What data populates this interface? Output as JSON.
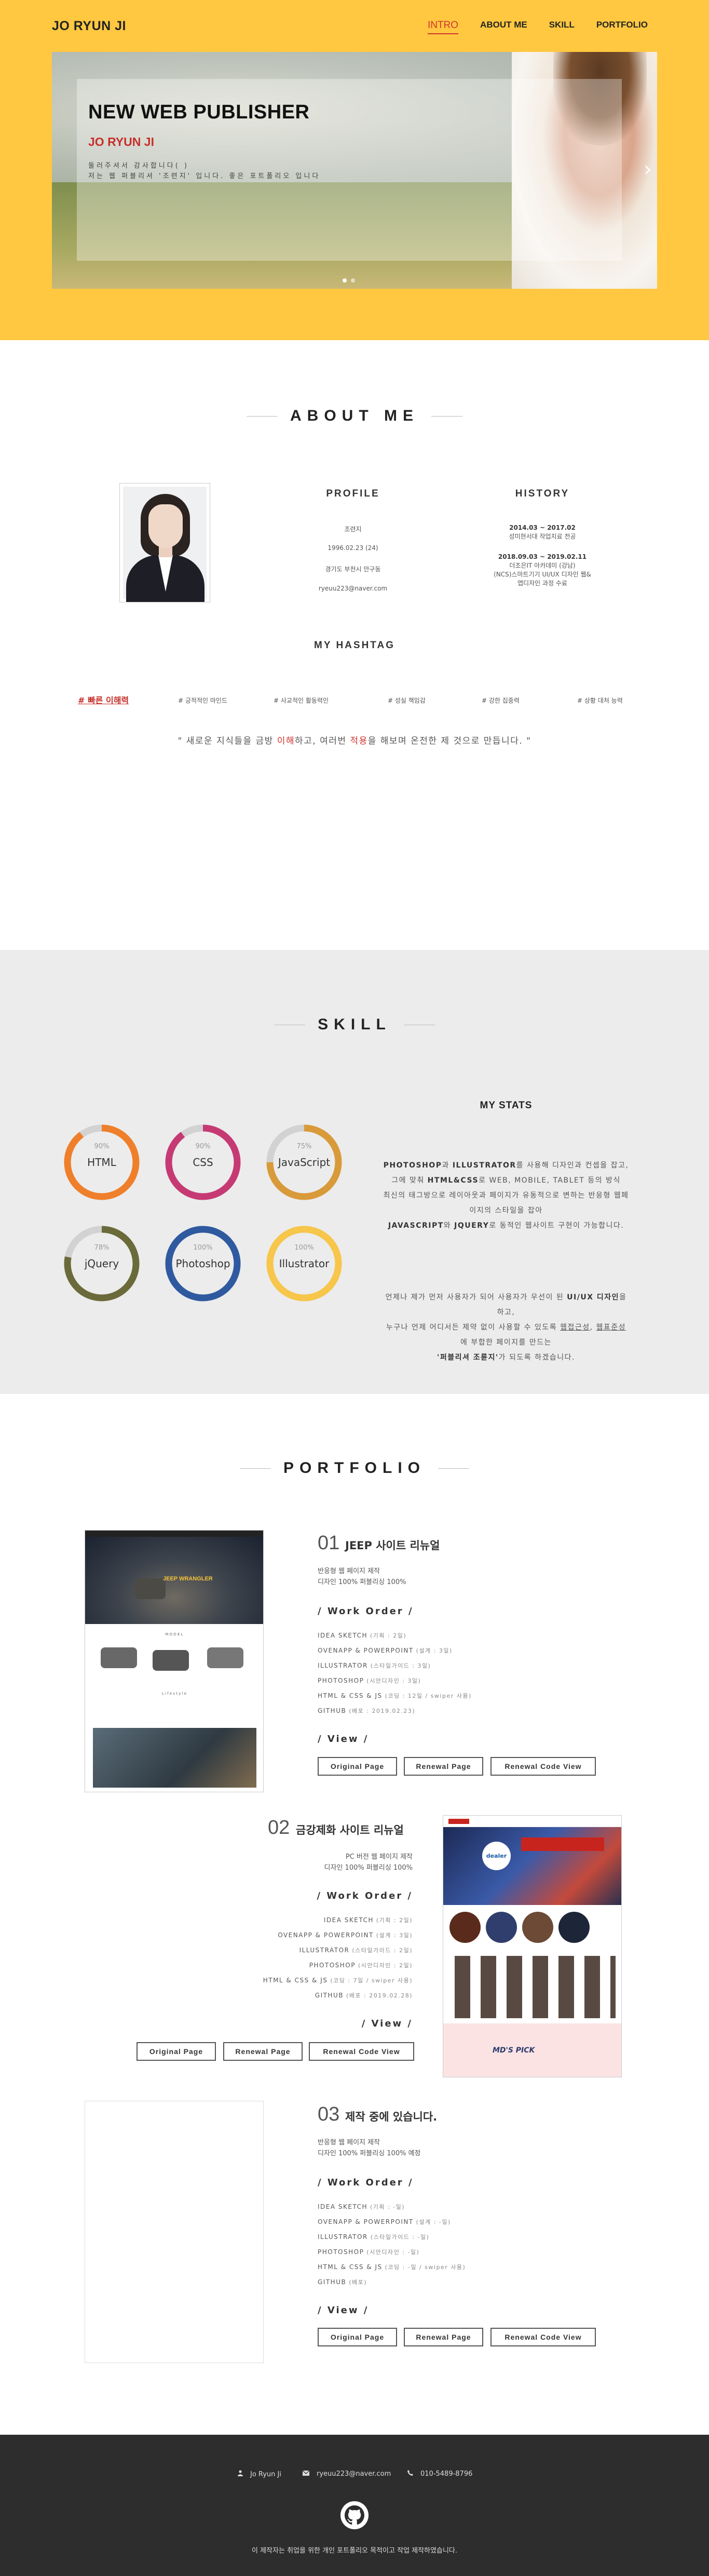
{
  "header": {
    "logo": "JO RYUN JI",
    "nav": [
      "INTRO",
      "ABOUT ME",
      "SKILL",
      "PORTFOLIO"
    ]
  },
  "hero": {
    "title": "NEW WEB PUBLISHER",
    "name": "JO RYUN JI",
    "intro_line1": "둘러주셔서 감사합니다(      )",
    "intro_line2": "저는 웹 퍼블리셔 '조련지' 입니다. 좋은 포트폴리오 입니다"
  },
  "about": {
    "title": "ABOUT ME",
    "profile_head": "PROFILE",
    "profile": [
      "조련지",
      "1996.02.23 (24)",
      "경기도 부천시 안구동",
      "ryeuu223@naver.com"
    ],
    "history_head": "HISTORY",
    "history": [
      {
        "date": "2014.03 ~ 2017.02",
        "desc": "성미현서대 작업치료 전공"
      },
      {
        "date": "2018.09.03 ~ 2019.02.11",
        "desc": "더조은IT 아카데미 (강남)",
        "desc2": "(NCS)스마트기기 UI/UX 디자인 웹&",
        "desc3": "앱디자인 과정 수료"
      }
    ],
    "hashtag_head": "MY HASHTAG",
    "hashtags": [
      "# 빠른 이해력",
      "# 긍적적인 마인드",
      "# 사교적인 활동력인",
      "# 성실 책임감",
      "# 강한 집중력",
      "# 상황 대처 능력"
    ],
    "quote_pre": "\" 새로운 지식들을 금방 ",
    "quote_red1": "이해",
    "quote_mid": "하고, 여러번 ",
    "quote_red2": "적용",
    "quote_post": "을 해보며 온전한 제 것으로 만듭니다. \""
  },
  "skill": {
    "title": "SKILL",
    "rings": [
      {
        "label": "HTML",
        "percent": "90%",
        "value": 0.9,
        "color": "#ef7f2a"
      },
      {
        "label": "CSS",
        "percent": "90%",
        "value": 0.9,
        "color": "#c63a74"
      },
      {
        "label": "JavaScript",
        "percent": "75%",
        "value": 0.75,
        "color": "#d99a3a"
      },
      {
        "label": "jQuery",
        "percent": "78%",
        "value": 0.78,
        "color": "#6b6a3a"
      },
      {
        "label": "Photoshop",
        "percent": "100%",
        "value": 1.0,
        "color": "#2f5aa0"
      },
      {
        "label": "Illustrator",
        "percent": "100%",
        "value": 1.0,
        "color": "#f7c64a"
      }
    ],
    "stats_title": "MY STATS",
    "p1_l1_b1": "PHOTOSHOP",
    "p1_l1_t1": "과 ",
    "p1_l1_b2": "ILLUSTRATOR",
    "p1_l1_t2": "를 사용해 디자인과 컨셉을 잡고,",
    "p1_l2_t1": "그에 맞춰 ",
    "p1_l2_b1": "HTML&CSS",
    "p1_l2_t2": "로 WEB, MOBILE, TABLET 등의 방식",
    "p1_l3": "최신의 태그방으로 레이아웃과 페이지가 유동적으로 변하는 반응형 웹페",
    "p1_l4": "이지의 스타일을 잡아",
    "p1_l5_b1": "JAVASCRIPT",
    "p1_l5_t1": "와 ",
    "p1_l5_b2": "JQUERY",
    "p1_l5_t2": "로 동적인 웹사이트 구현이 가능합니다.",
    "p2_l1_t1": "언제나 제가 먼저 사용자가 되어 사용자가 우선이 된 ",
    "p2_l1_b1": "UI/UX 디자인",
    "p2_l1_t2": "을",
    "p2_l2": "하고,",
    "p2_l3_t1": "누구나 언제 어디서든 제약 없이 사용할 수 있도록 ",
    "p2_l3_u1": "웹접근성",
    "p2_l3_t2": ", ",
    "p2_l3_u2": "웹표준성",
    "p2_l4": "에 부합한 페이지를 만드는",
    "p2_l5_b1": "'퍼블리셔 조륜지'",
    "p2_l5_t1": "가 되도록 하겠습니다."
  },
  "portfolio": {
    "title": "PORTFOLIO",
    "items": [
      {
        "num": "01",
        "name": "JEEP 사이트 리뉴얼",
        "meta1": "반응형 웹 페이지 제작",
        "meta2": "디자인 100% 퍼블리싱 100%",
        "work_head": "/ Work Order /",
        "work": [
          {
            "t": "IDEA SKETCH",
            "s": " (기획 : 2일)"
          },
          {
            "t": "OVENAPP & POWERPOINT",
            "s": " (설계 : 3일)"
          },
          {
            "t": "ILLUSTRATOR",
            "s": " (스타일가이드 : 3일)"
          },
          {
            "t": "PHOTOSHOP",
            "s": " (시안디자인 : 3일)"
          },
          {
            "t": "HTML & CSS & JS",
            "s": " (코딩 : 12일 / swiper 사용)"
          },
          {
            "t": "GITHUB",
            "s": " (배포 : 2019.02.23)"
          }
        ],
        "view_head": "/ View /",
        "buttons": [
          "Original Page",
          "Renewal Page",
          "Renewal Code View"
        ]
      },
      {
        "num": "02",
        "name": "금강제화 사이트 리뉴얼",
        "meta1": "PC 버전 웹 페이지 제작",
        "meta2": "디자인 100% 퍼블리싱 100%",
        "work_head": "/ Work Order /",
        "work": [
          {
            "t": "IDEA SKETCH",
            "s": " (기획 : 2일)"
          },
          {
            "t": "OVENAPP & POWERPOINT",
            "s": " (설계 : 3일)"
          },
          {
            "t": "ILLUSTRATOR",
            "s": " (스타일가이드 : 2일)"
          },
          {
            "t": "PHOTOSHOP",
            "s": " (시안디자인 : 2일)"
          },
          {
            "t": "HTML & CSS & JS",
            "s": " (코딩 : 7일 / swiper 사용)"
          },
          {
            "t": "GITHUB",
            "s": " (배포 : 2019.02.28)"
          }
        ],
        "view_head": "/ View /",
        "buttons": [
          "Original Page",
          "Renewal Page",
          "Renewal Code View"
        ]
      },
      {
        "num": "03",
        "name": "제작 중에 있습니다.",
        "meta1": "반응형 웹 페이지 제작",
        "meta2": "디자인 100% 퍼블리싱 100% 예정",
        "work_head": "/ Work Order /",
        "work": [
          {
            "t": "IDEA SKETCH",
            "s": " (기획 : -일)"
          },
          {
            "t": "OVENAPP & POWERPOINT",
            "s": " (설계 : -일)"
          },
          {
            "t": "ILLUSTRATOR",
            "s": " (스타일가이드 : -일)"
          },
          {
            "t": "PHOTOSHOP",
            "s": " (시안디자인 : -일)"
          },
          {
            "t": "HTML & CSS & JS",
            "s": " (코딩 : -일 / swiper 사용)"
          },
          {
            "t": "GITHUB",
            "s": " (배포)"
          }
        ],
        "view_head": "/ View /",
        "buttons": [
          "Original Page",
          "Renewal Page",
          "Renewal Code View"
        ]
      }
    ],
    "shot1": {
      "brand": "JEEP WRANGLER",
      "model": "M O D E L",
      "lifestyle": "L i f e s t y l e"
    },
    "shot2": {
      "brand": "dealer",
      "pick": "MD'S PICK"
    }
  },
  "footer": {
    "name": "Jo Ryun Ji",
    "email": "ryeuu223@naver.com",
    "phone": "010-5489-8796",
    "copyright": "이 제작자는 취업을 위한 개인 포트폴리오 목적이고 작업 제작하였습니다."
  },
  "colors": {
    "hero_bg": "#ffc840",
    "accent_red": "#d1342f",
    "skill_bg": "#ececec",
    "footer_bg": "#2d2d2d"
  }
}
